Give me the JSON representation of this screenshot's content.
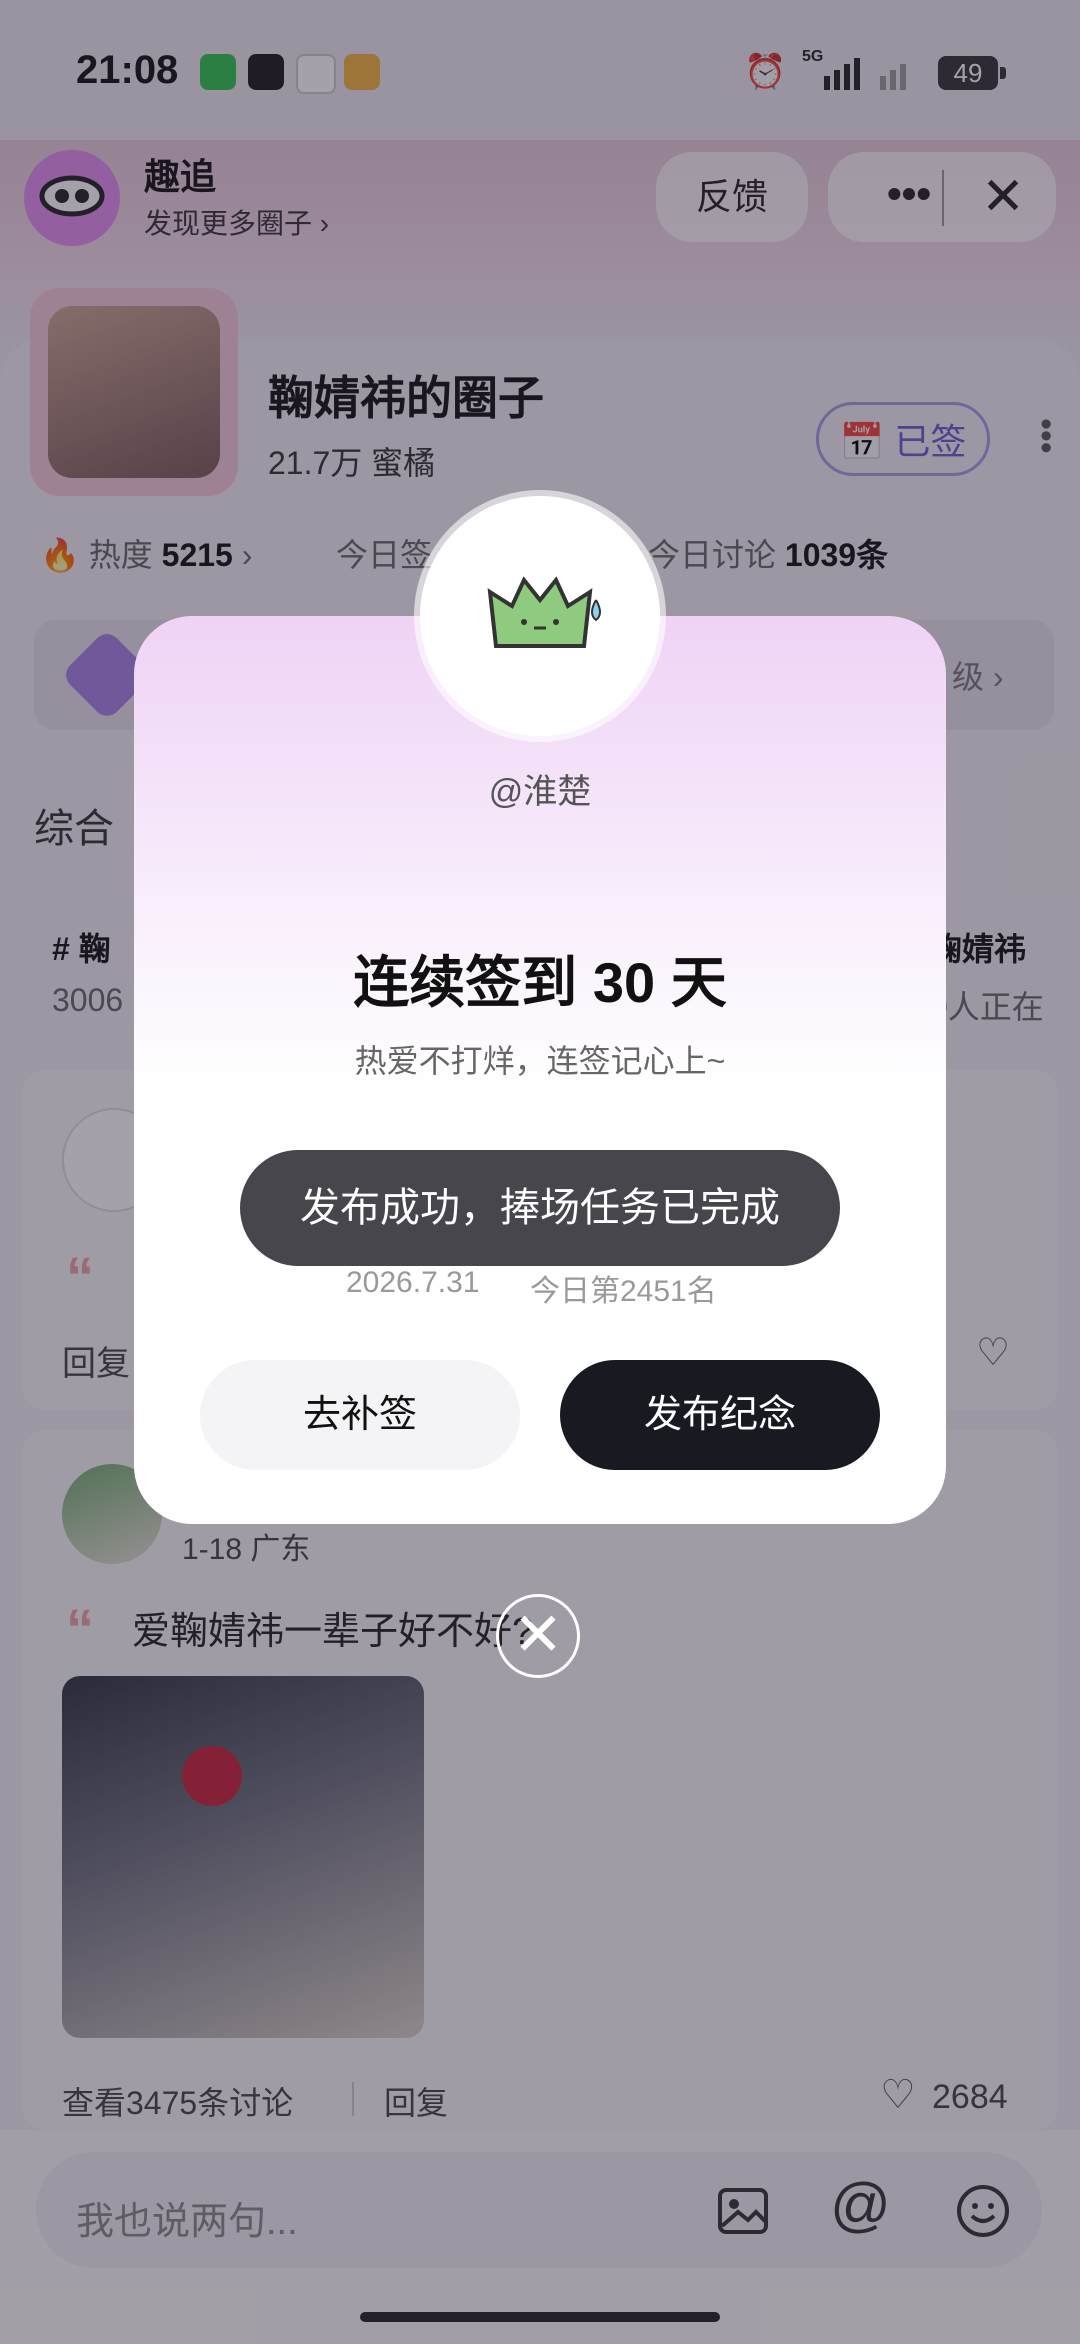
{
  "status_bar": {
    "time": "21:08",
    "network": "5G",
    "battery": "49"
  },
  "header": {
    "app_name": "趣追",
    "app_sub": "发现更多圈子",
    "feedback": "反馈",
    "more": "•••",
    "close": "✕"
  },
  "group": {
    "name": "鞠婧祎的圈子",
    "count": "21.7万 蜜橘",
    "signed": "已签",
    "heat_label": "热度",
    "heat_value": "5215",
    "today_sign_label": "今日签",
    "today_discuss_label": "今日讨论",
    "today_discuss_value": "1039条",
    "level_hint": "级",
    "tab": "综合"
  },
  "topics": [
    {
      "title": "鞠",
      "sub": "3006"
    },
    {
      "title": "鞠婧祎",
      "sub": "0人正在"
    }
  ],
  "post1": {
    "reply": "回复"
  },
  "post2": {
    "meta": "1-18 广东",
    "text": "爱鞠婧祎一辈子好不好?",
    "discussions": "查看3475条讨论",
    "reply": "回复",
    "likes": "2684"
  },
  "input": {
    "placeholder": "我也说两句..."
  },
  "dialog": {
    "handle": "@淮楚",
    "title": "连续签到 30 天",
    "subtitle": "热爱不打烊，连签记心上~",
    "toast": "发布成功，捧场任务已完成",
    "date": "2026.7.31",
    "rank": "今日第2451名",
    "btn_makeup": "去补签",
    "btn_publish": "发布纪念",
    "close": "✕"
  }
}
